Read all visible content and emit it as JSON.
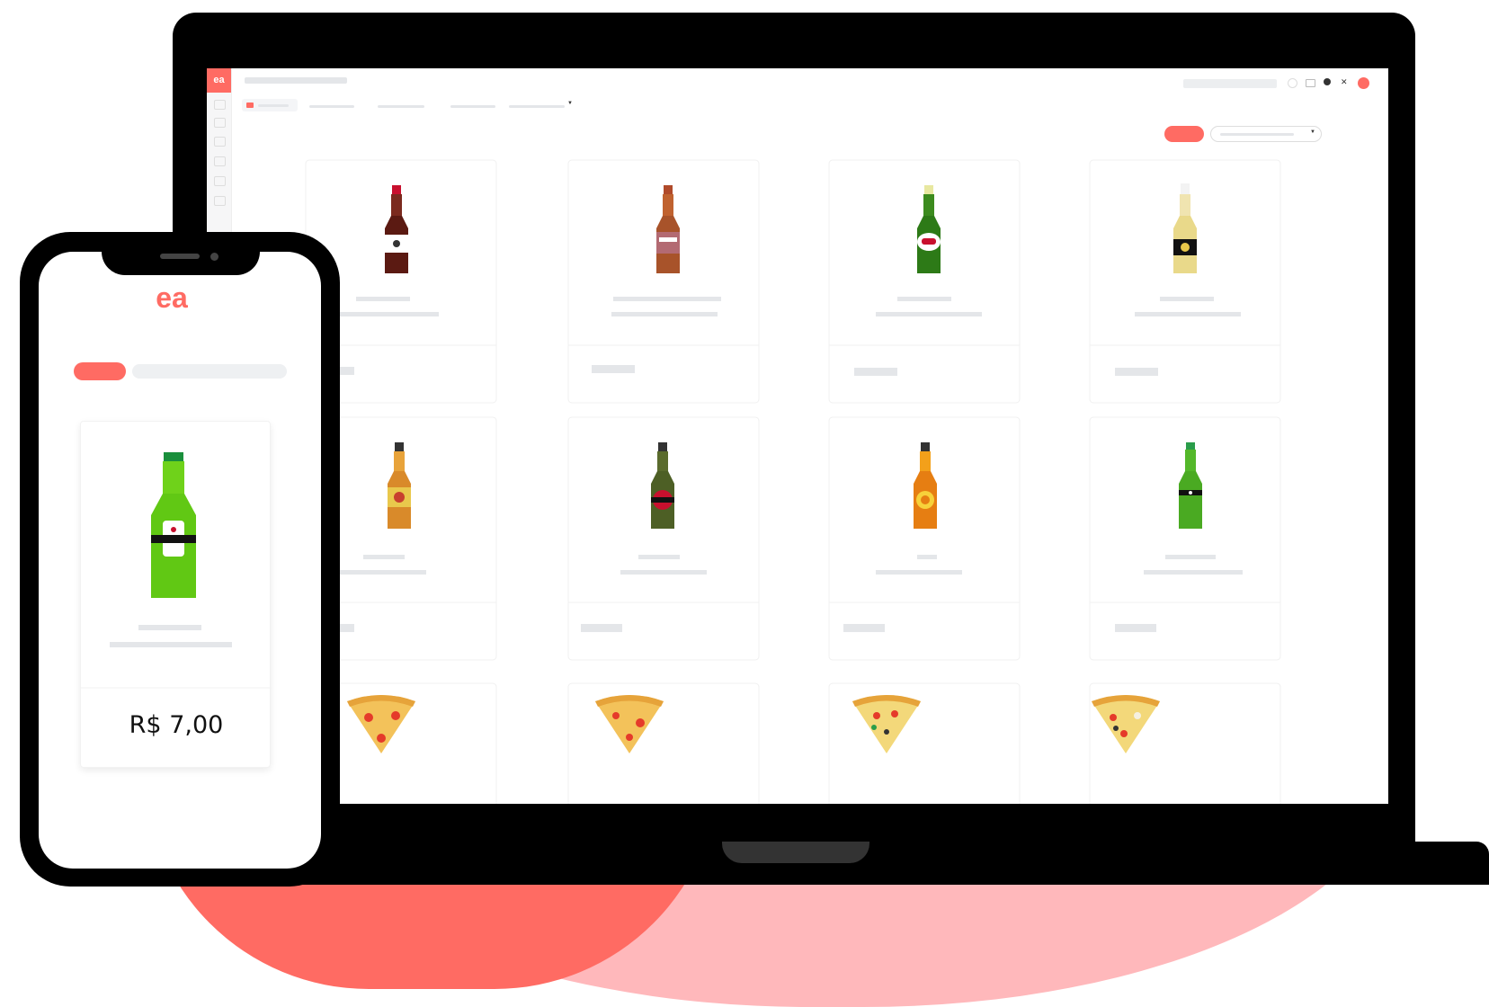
{
  "brand": {
    "logo_text": "ea",
    "accent": "#ff6b63"
  },
  "mobile": {
    "featured_product": {
      "icon": "green-beer-bottle-icon",
      "price": "R$  7,00"
    }
  },
  "desktop": {
    "products": [
      {
        "icon": "dark-beer-bottle-icon"
      },
      {
        "icon": "amber-beer-bottle-icon"
      },
      {
        "icon": "green-beer-bottle-icon"
      },
      {
        "icon": "pale-beer-bottle-icon"
      },
      {
        "icon": "amber-beer-bottle-icon"
      },
      {
        "icon": "olive-beer-bottle-icon"
      },
      {
        "icon": "orange-beer-bottle-icon"
      },
      {
        "icon": "green-beer-bottle-icon"
      },
      {
        "icon": "pizza-slice-icon"
      },
      {
        "icon": "pizza-slice-icon"
      },
      {
        "icon": "pizza-slice-icon"
      },
      {
        "icon": "pizza-slice-icon"
      }
    ]
  }
}
